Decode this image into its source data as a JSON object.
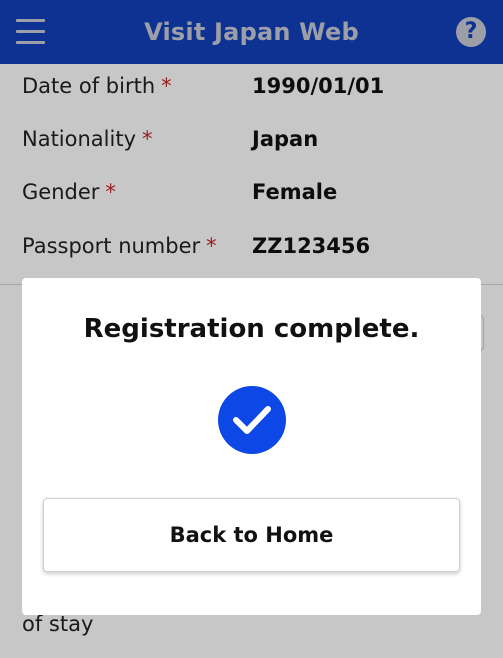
{
  "header": {
    "title": "Visit Japan Web",
    "menu_icon": "hamburger-menu-icon",
    "help_icon": "help-icon",
    "help_glyph": "?"
  },
  "details": {
    "required_marker": "*",
    "rows": [
      {
        "label": "Date of birth",
        "value": "1990/01/01"
      },
      {
        "label": "Nationality",
        "value": "Japan"
      },
      {
        "label": "Gender",
        "value": "Female"
      },
      {
        "label": "Passport number",
        "value": "ZZ123456"
      }
    ],
    "trailing_text": "of stay"
  },
  "modal": {
    "title": "Registration complete.",
    "status_icon": "checkmark-circle-icon",
    "button_label": "Back to Home"
  },
  "colors": {
    "brand": "#1340ba",
    "accent": "#0d47e6",
    "required": "#c62828"
  }
}
